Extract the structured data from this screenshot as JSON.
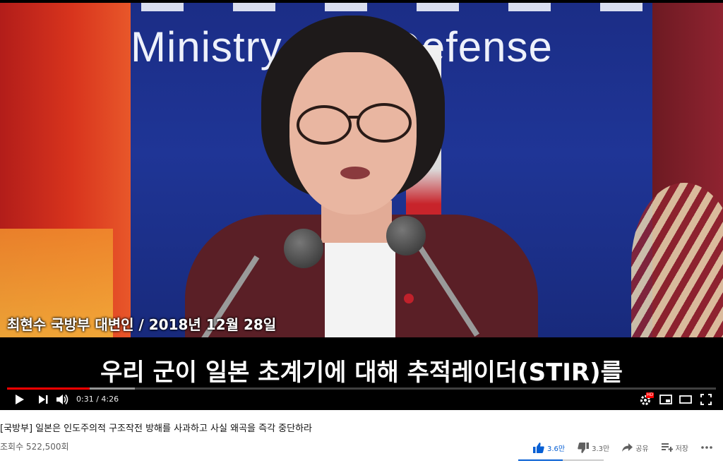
{
  "video": {
    "background_sign": "Ministry   onal Defense",
    "caption_speaker": "최현수 국방부 대변인 / 2018년 12월 28일",
    "caption_subtitle": "우리 군이 일본 초계기에 대해 추적레이더(STIR)를",
    "progress": {
      "played_fraction": 0.117,
      "buffered_fraction": 0.18
    }
  },
  "controls": {
    "current_time": "0:31",
    "duration": "4:26",
    "time_display": "0:31 / 4:26",
    "hd_badge": "HD"
  },
  "info": {
    "title": "[국방부] 일본은 인도주의적 구조작전 방해를 사과하고 사실 왜곡을 즉각 중단하라",
    "views": "조회수 522,500회",
    "likes": "3.6만",
    "dislikes": "3.3만",
    "share_label": "공유",
    "save_label": "저장",
    "like_ratio": 0.52
  },
  "colors": {
    "progress_played": "#ff0000",
    "like_accent": "#065fd4",
    "player_bg": "#000000"
  }
}
